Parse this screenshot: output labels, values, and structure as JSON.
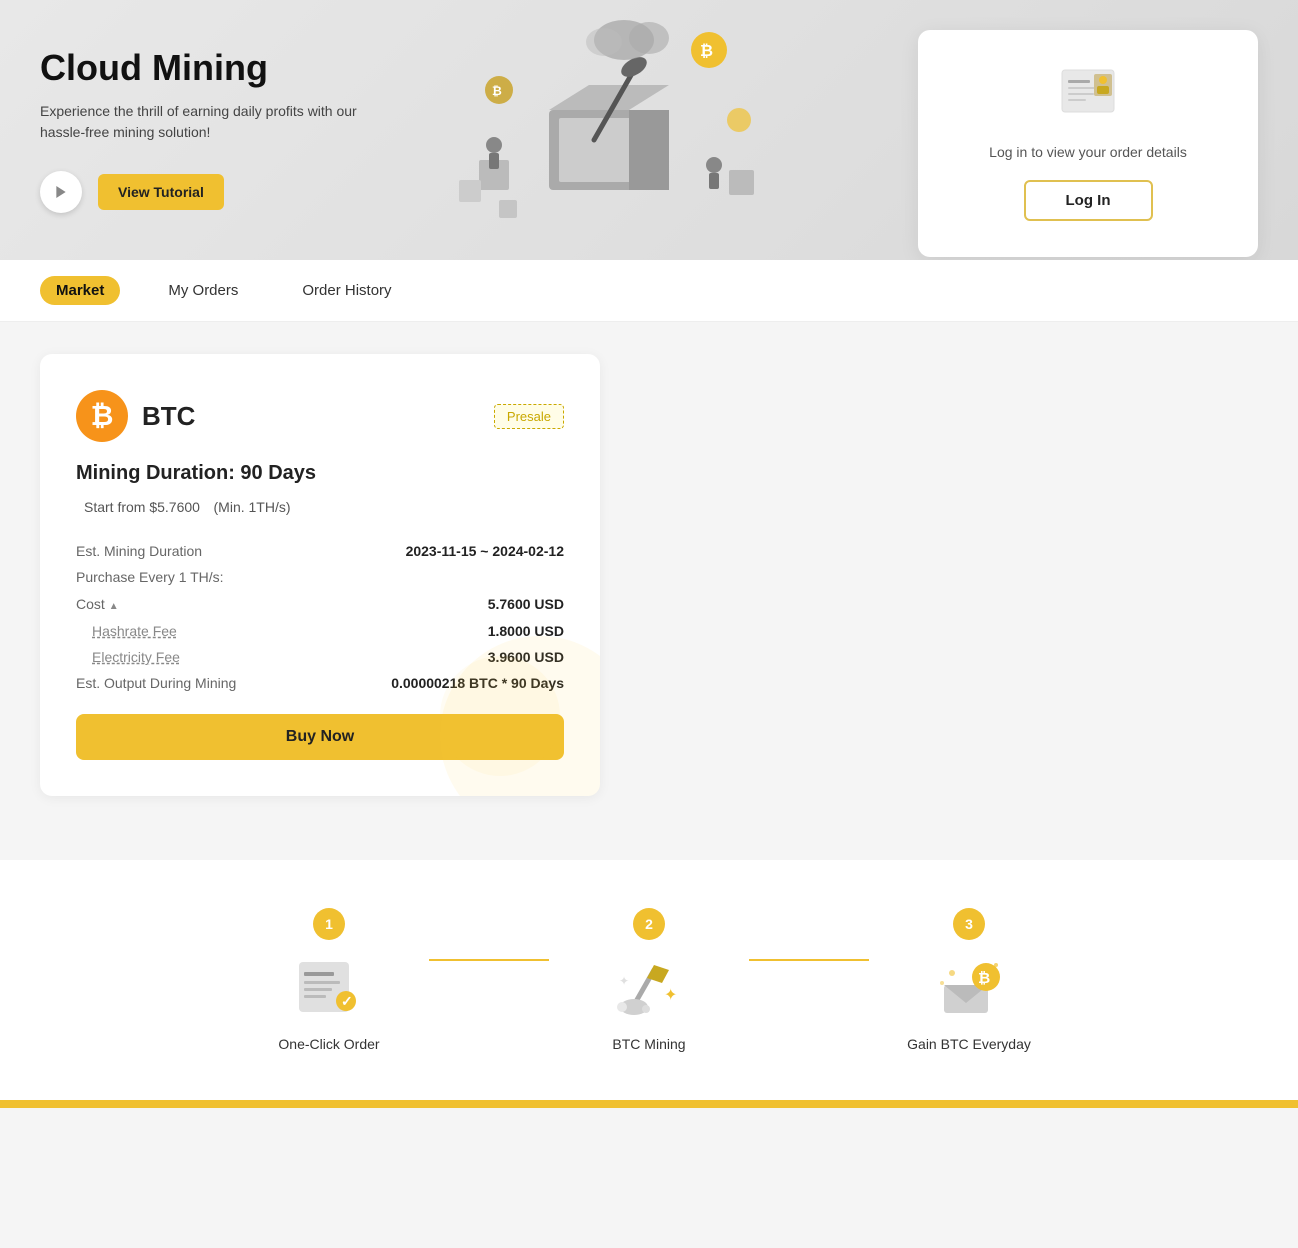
{
  "hero": {
    "title": "Cloud Mining",
    "subtitle": "Experience the thrill of earning daily profits with our hassle-free mining solution!",
    "tutorial_button": "View Tutorial",
    "card": {
      "text": "Log in to view your order details",
      "login_button": "Log In"
    }
  },
  "tabs": {
    "items": [
      {
        "id": "market",
        "label": "Market",
        "active": true
      },
      {
        "id": "my-orders",
        "label": "My Orders",
        "active": false
      },
      {
        "id": "order-history",
        "label": "Order History",
        "active": false
      }
    ]
  },
  "mining_card": {
    "coin_name": "BTC",
    "presale_badge": "Presale",
    "duration_label": "Mining Duration: 90 Days",
    "start_from_label": "Start from $5.7600",
    "start_from_sub": "(Min. 1TH/s)",
    "details": {
      "est_mining_duration_label": "Est. Mining Duration",
      "est_mining_duration_value": "2023-11-15 ~ 2024-02-12",
      "purchase_label": "Purchase Every 1 TH/s:",
      "cost_label": "Cost",
      "cost_value": "5.7600 USD",
      "hashrate_fee_label": "Hashrate Fee",
      "hashrate_fee_value": "1.8000 USD",
      "electricity_fee_label": "Electricity Fee",
      "electricity_fee_value": "3.9600 USD",
      "est_output_label": "Est. Output During Mining",
      "est_output_value": "0.00000218 BTC * 90 Days"
    },
    "buy_button": "Buy Now"
  },
  "steps": {
    "items": [
      {
        "num": "1",
        "label": "One-Click Order"
      },
      {
        "num": "2",
        "label": "BTC Mining"
      },
      {
        "num": "3",
        "label": "Gain BTC Everyday"
      }
    ]
  }
}
